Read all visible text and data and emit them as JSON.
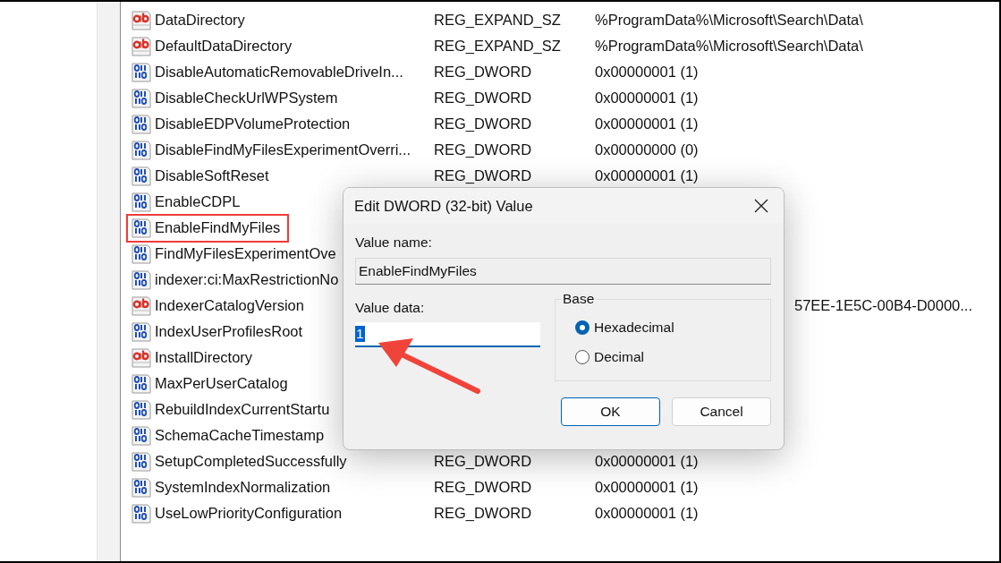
{
  "values": [
    {
      "kind": "string",
      "name": "DataDirectory",
      "type": "REG_EXPAND_SZ",
      "data": "%ProgramData%\\Microsoft\\Search\\Data\\",
      "highlighted": false
    },
    {
      "kind": "string",
      "name": "DefaultDataDirectory",
      "type": "REG_EXPAND_SZ",
      "data": "%ProgramData%\\Microsoft\\Search\\Data\\",
      "highlighted": false
    },
    {
      "kind": "dword",
      "name": "DisableAutomaticRemovableDriveIn...",
      "type": "REG_DWORD",
      "data": "0x00000001 (1)",
      "highlighted": false
    },
    {
      "kind": "dword",
      "name": "DisableCheckUrlWPSystem",
      "type": "REG_DWORD",
      "data": "0x00000001 (1)",
      "highlighted": false
    },
    {
      "kind": "dword",
      "name": "DisableEDPVolumeProtection",
      "type": "REG_DWORD",
      "data": "0x00000001 (1)",
      "highlighted": false
    },
    {
      "kind": "dword",
      "name": "DisableFindMyFilesExperimentOverri...",
      "type": "REG_DWORD",
      "data": "0x00000000 (0)",
      "highlighted": false
    },
    {
      "kind": "dword",
      "name": "DisableSoftReset",
      "type": "REG_DWORD",
      "data": "0x00000001 (1)",
      "highlighted": false
    },
    {
      "kind": "dword",
      "name": "EnableCDPL",
      "highlighted": false
    },
    {
      "kind": "dword",
      "name": "EnableFindMyFiles",
      "highlighted": true
    },
    {
      "kind": "dword",
      "name": "FindMyFilesExperimentOve",
      "highlighted": false
    },
    {
      "kind": "dword",
      "name": "indexer:ci:MaxRestrictionNo",
      "highlighted": false
    },
    {
      "kind": "string",
      "name": "IndexerCatalogVersion",
      "data": "57EE-1E5C-00B4-D0000...",
      "data_cut_start": true,
      "highlighted": false
    },
    {
      "kind": "dword",
      "name": "IndexUserProfilesRoot",
      "highlighted": false
    },
    {
      "kind": "string",
      "name": "InstallDirectory",
      "highlighted": false
    },
    {
      "kind": "dword",
      "name": "MaxPerUserCatalog",
      "highlighted": false
    },
    {
      "kind": "dword",
      "name": "RebuildIndexCurrentStartu",
      "highlighted": false
    },
    {
      "kind": "dword",
      "name": "SchemaCacheTimestamp",
      "highlighted": false
    },
    {
      "kind": "dword",
      "name": "SetupCompletedSuccessfully",
      "type": "REG_DWORD",
      "data": "0x00000001 (1)",
      "highlighted": false
    },
    {
      "kind": "dword",
      "name": "SystemIndexNormalization",
      "type": "REG_DWORD",
      "data": "0x00000001 (1)",
      "highlighted": false
    },
    {
      "kind": "dword",
      "name": "UseLowPriorityConfiguration",
      "type": "REG_DWORD",
      "data": "0x00000001 (1)",
      "highlighted": false
    }
  ],
  "dialog": {
    "title": "Edit DWORD (32-bit) Value",
    "value_name_label": "Value name:",
    "value_name": "EnableFindMyFiles",
    "value_data_label": "Value data:",
    "value_data": "1",
    "value_data_selected": true,
    "base_label": "Base",
    "bases": [
      {
        "label": "Hexadecimal",
        "selected": true
      },
      {
        "label": "Decimal",
        "selected": false
      }
    ],
    "buttons": [
      {
        "label": "OK",
        "default": true
      },
      {
        "label": "Cancel",
        "default": false
      }
    ]
  },
  "annotation": {
    "kind": "arrow"
  }
}
